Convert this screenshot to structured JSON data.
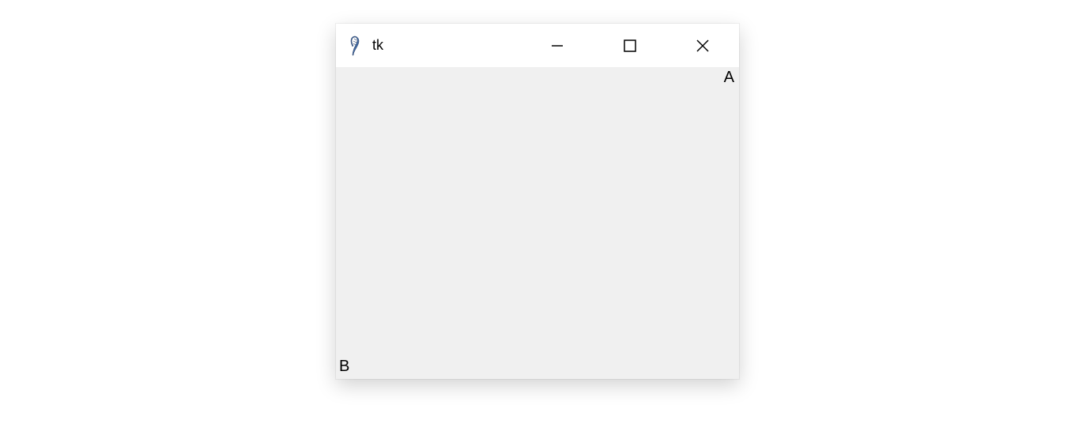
{
  "window": {
    "title": "tk",
    "icon_name": "tk-feather-icon"
  },
  "controls": {
    "minimize": "minimize",
    "maximize": "maximize",
    "close": "close"
  },
  "content": {
    "label_a": "A",
    "label_b": "B"
  }
}
